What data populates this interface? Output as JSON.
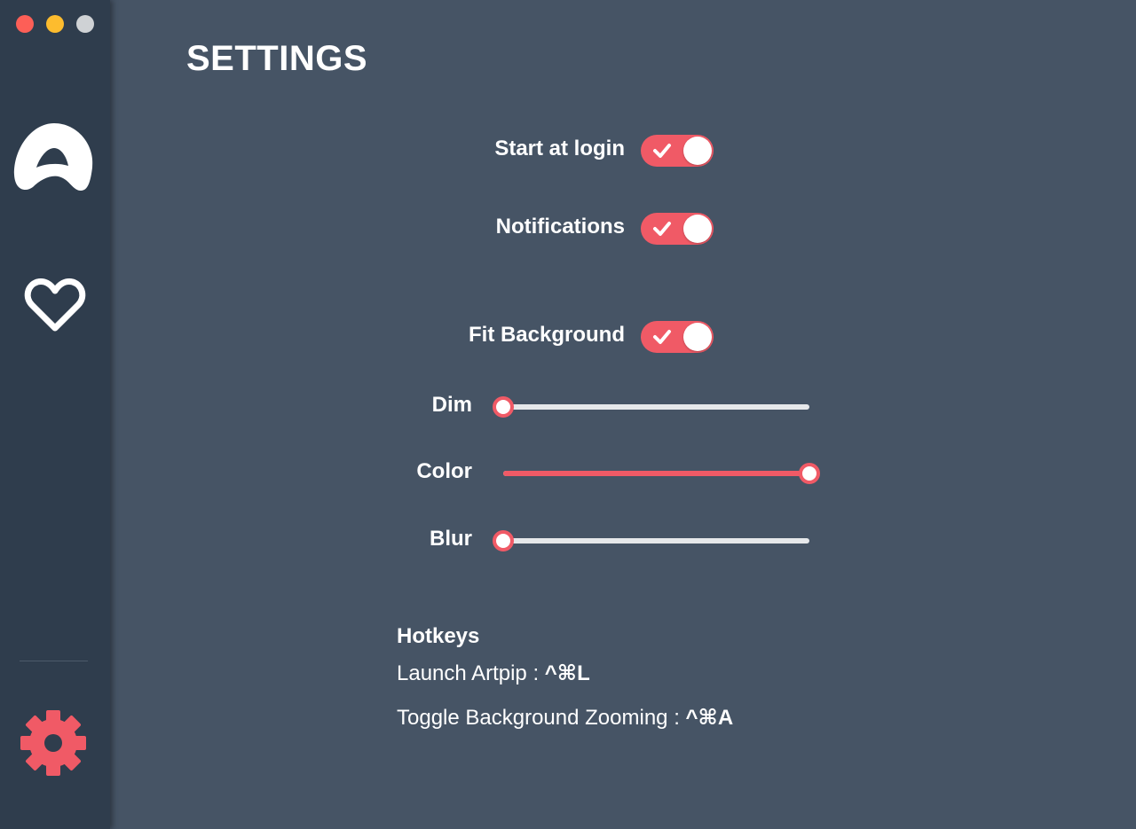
{
  "window": {
    "controls": [
      "close",
      "minimize",
      "maximize"
    ]
  },
  "sidebar": {
    "items": [
      {
        "icon": "artpip-logo-icon",
        "active": false
      },
      {
        "icon": "heart-icon",
        "active": false
      },
      {
        "icon": "gear-icon",
        "active": true
      }
    ]
  },
  "page": {
    "title": "SETTINGS"
  },
  "settings": {
    "start_at_login": {
      "label": "Start at login",
      "checked": true
    },
    "notifications": {
      "label": "Notifications",
      "checked": true
    },
    "fit_background": {
      "label": "Fit Background",
      "checked": true
    },
    "dim": {
      "label": "Dim",
      "value_fraction": 0.0
    },
    "color": {
      "label": "Color",
      "value_fraction": 1.0
    },
    "blur": {
      "label": "Blur",
      "value_fraction": 0.0
    }
  },
  "hotkeys": {
    "title": "Hotkeys",
    "launch": {
      "label": "Launch Artpip : ",
      "keys": "^⌘L"
    },
    "toggle_zoom": {
      "label": "Toggle Background Zooming : ",
      "keys": "^⌘A"
    }
  },
  "colors": {
    "accent": "#f05a66",
    "background": "#465465",
    "sidebar": "#2f3d4d",
    "track": "#e6e8ea"
  }
}
